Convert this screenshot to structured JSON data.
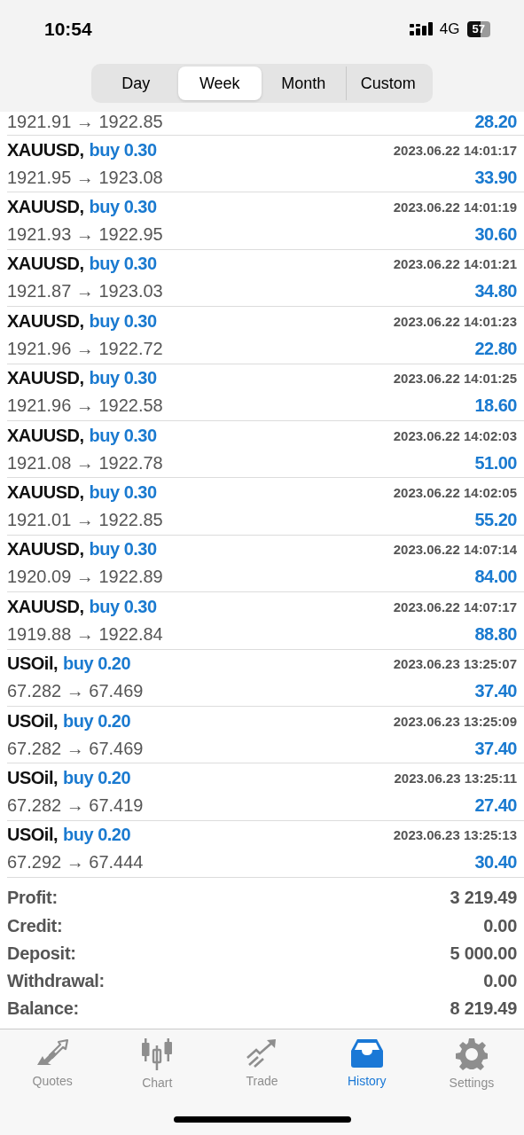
{
  "status_bar": {
    "time": "10:54",
    "network": "4G",
    "battery": "57"
  },
  "period_tabs": [
    {
      "label": "Day",
      "selected": false
    },
    {
      "label": "Week",
      "selected": true
    },
    {
      "label": "Month",
      "selected": false
    },
    {
      "label": "Custom",
      "selected": false
    }
  ],
  "deals": [
    {
      "prices": "1921.91 → 1922.85",
      "profit": "28.20"
    },
    {
      "symbol": "XAUUSD,",
      "side": "buy 0.30",
      "time": "2023.06.22 14:01:17",
      "prices": "1921.95 → 1923.08",
      "profit": "33.90"
    },
    {
      "symbol": "XAUUSD,",
      "side": "buy 0.30",
      "time": "2023.06.22 14:01:19",
      "prices": "1921.93 → 1922.95",
      "profit": "30.60"
    },
    {
      "symbol": "XAUUSD,",
      "side": "buy 0.30",
      "time": "2023.06.22 14:01:21",
      "prices": "1921.87 → 1923.03",
      "profit": "34.80"
    },
    {
      "symbol": "XAUUSD,",
      "side": "buy 0.30",
      "time": "2023.06.22 14:01:23",
      "prices": "1921.96 → 1922.72",
      "profit": "22.80"
    },
    {
      "symbol": "XAUUSD,",
      "side": "buy 0.30",
      "time": "2023.06.22 14:01:25",
      "prices": "1921.96 → 1922.58",
      "profit": "18.60"
    },
    {
      "symbol": "XAUUSD,",
      "side": "buy 0.30",
      "time": "2023.06.22 14:02:03",
      "prices": "1921.08 → 1922.78",
      "profit": "51.00"
    },
    {
      "symbol": "XAUUSD,",
      "side": "buy 0.30",
      "time": "2023.06.22 14:02:05",
      "prices": "1921.01 → 1922.85",
      "profit": "55.20"
    },
    {
      "symbol": "XAUUSD,",
      "side": "buy 0.30",
      "time": "2023.06.22 14:07:14",
      "prices": "1920.09 → 1922.89",
      "profit": "84.00"
    },
    {
      "symbol": "XAUUSD,",
      "side": "buy 0.30",
      "time": "2023.06.22 14:07:17",
      "prices": "1919.88 → 1922.84",
      "profit": "88.80"
    },
    {
      "symbol": "USOil,",
      "side": "buy 0.20",
      "time": "2023.06.23 13:25:07",
      "prices": "67.282 → 67.469",
      "profit": "37.40"
    },
    {
      "symbol": "USOil,",
      "side": "buy 0.20",
      "time": "2023.06.23 13:25:09",
      "prices": "67.282 → 67.469",
      "profit": "37.40"
    },
    {
      "symbol": "USOil,",
      "side": "buy 0.20",
      "time": "2023.06.23 13:25:11",
      "prices": "67.282 → 67.419",
      "profit": "27.40"
    },
    {
      "symbol": "USOil,",
      "side": "buy 0.20",
      "time": "2023.06.23 13:25:13",
      "prices": "67.292 → 67.444",
      "profit": "30.40"
    }
  ],
  "summary": [
    {
      "label": "Profit:",
      "value": "3 219.49"
    },
    {
      "label": "Credit:",
      "value": "0.00"
    },
    {
      "label": "Deposit:",
      "value": "5 000.00"
    },
    {
      "label": "Withdrawal:",
      "value": "0.00"
    },
    {
      "label": "Balance:",
      "value": "8 219.49"
    }
  ],
  "tab_bar": [
    {
      "kind": "quotes",
      "label": "Quotes",
      "selected": false
    },
    {
      "kind": "chart",
      "label": "Chart",
      "selected": false
    },
    {
      "kind": "trade",
      "label": "Trade",
      "selected": false
    },
    {
      "kind": "history",
      "label": "History",
      "selected": true
    },
    {
      "kind": "settings",
      "label": "Settings",
      "selected": false
    }
  ]
}
